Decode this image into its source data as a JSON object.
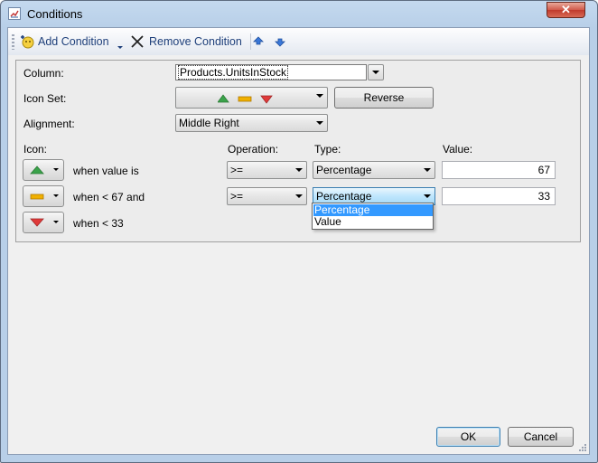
{
  "window": {
    "title": "Conditions",
    "close_glyph": "✕"
  },
  "toolbar": {
    "add_label": "Add Condition",
    "remove_label": "Remove Condition"
  },
  "form": {
    "column_label": "Column:",
    "column_value": "Products.UnitsInStock",
    "iconset_label": "Icon Set:",
    "reverse_label": "Reverse",
    "alignment_label": "Alignment:",
    "alignment_value": "Middle Right",
    "headers": {
      "icon": "Icon:",
      "operation": "Operation:",
      "type": "Type:",
      "value": "Value:"
    },
    "rows": [
      {
        "icon": "green-up-triangle",
        "condition": "when value is",
        "operation": "&gt;=",
        "type": "Percentage",
        "value": "67"
      },
      {
        "icon": "yellow-bar",
        "condition": "when < 67 and",
        "operation": "&gt;=",
        "type": "Percentage",
        "value": "33"
      },
      {
        "icon": "red-down-triangle",
        "condition": "when < 33"
      }
    ],
    "type_dropdown_options": [
      "Percentage",
      "Value"
    ],
    "type_dropdown_selected": "Percentage"
  },
  "footer": {
    "ok_label": "OK",
    "cancel_label": "Cancel"
  },
  "colors": {
    "green": "#3aa24a",
    "yellow": "#f0b000",
    "red": "#e03a3a",
    "selection": "#3399ff"
  }
}
